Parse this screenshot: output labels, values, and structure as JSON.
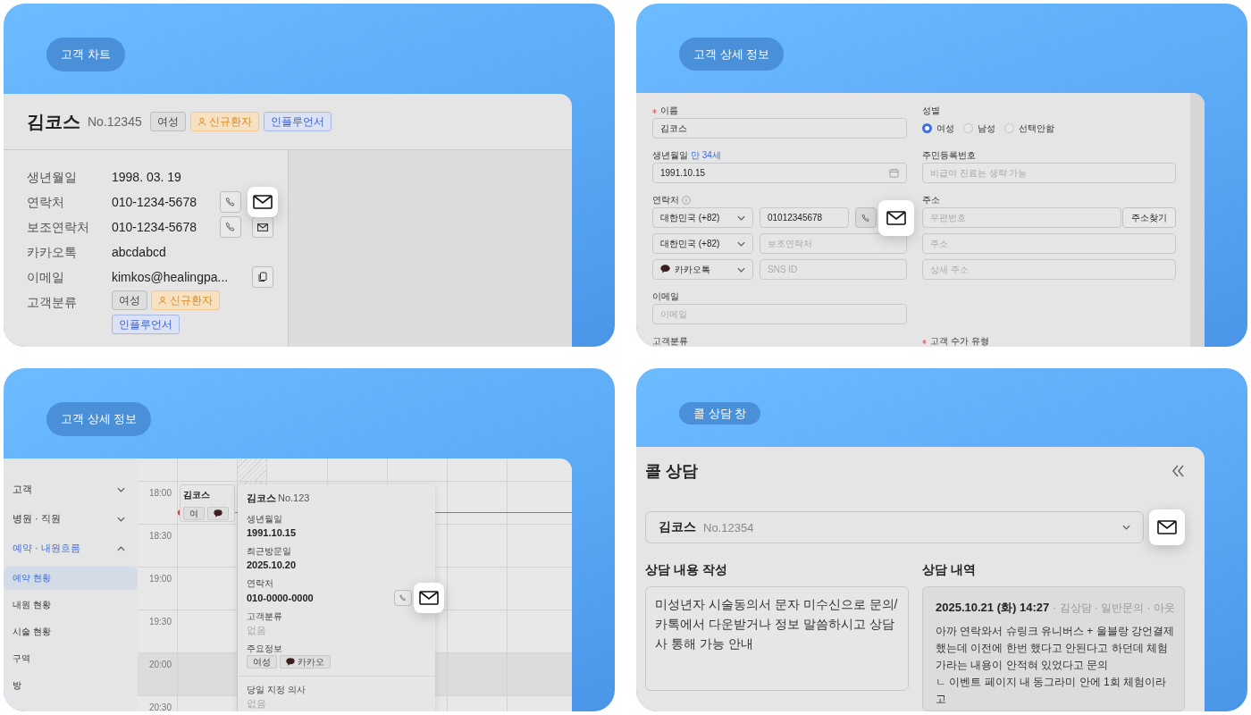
{
  "chart_panel": {
    "label": "고객 차트",
    "name": "김코스",
    "number": "No.12345",
    "tags": [
      {
        "text": "여성",
        "kind": "plain"
      },
      {
        "text": "신규환자",
        "kind": "new"
      },
      {
        "text": "인플루언서",
        "kind": "influencer"
      }
    ],
    "rows": [
      {
        "label": "생년월일",
        "kind": "text",
        "value": "1998. 03. 19"
      },
      {
        "label": "연락처",
        "kind": "contact",
        "value": "010-1234-5678",
        "highlighted": true
      },
      {
        "label": "보조연락처",
        "kind": "contact",
        "value": "010-1234-5678",
        "highlighted": false
      },
      {
        "label": "카카오톡",
        "kind": "text",
        "value": "abcdabcd"
      },
      {
        "label": "이메일",
        "kind": "copy",
        "value": "kimkos@healingpa..."
      },
      {
        "label": "고객분류",
        "kind": "tags",
        "tags": [
          {
            "text": "여성",
            "kind": "plain"
          },
          {
            "text": "신규환자",
            "kind": "new"
          },
          {
            "text": "인플루언서",
            "kind": "influencer"
          }
        ]
      }
    ]
  },
  "form_panel": {
    "label": "고객 상세 정보",
    "name": {
      "label": "이름",
      "required": true,
      "value": "김코스"
    },
    "gender": {
      "label": "성별",
      "options": [
        {
          "text": "여성",
          "selected": true
        },
        {
          "text": "남성",
          "selected": false
        },
        {
          "text": "선택안함",
          "selected": false
        }
      ]
    },
    "birth": {
      "label": "생년월일",
      "age": "만 34세",
      "value": "1991.10.15"
    },
    "rrn": {
      "label": "주민등록번호",
      "placeholder": "비급여 진료는 생략 가능"
    },
    "contact": {
      "label": "연락처",
      "rows": [
        {
          "kind": "phone",
          "country": "대한민국 (+82)",
          "value": "01012345678",
          "actions": true
        },
        {
          "kind": "phone",
          "country": "대한민국 (+82)",
          "placeholder": "보조연락처",
          "actions": false
        },
        {
          "kind": "sns",
          "country": "카카오톡",
          "placeholder": "SNS ID",
          "actions": false
        }
      ]
    },
    "address": {
      "label": "주소",
      "zip_placeholder": "우편번호",
      "search_button": "주소찾기",
      "address_placeholder": "주소",
      "detail_placeholder": "상세 주소"
    },
    "email": {
      "label": "이메일",
      "placeholder": "이메일"
    },
    "classification": {
      "label": "고객분류"
    },
    "fee_type": {
      "label": "고객 수가 유형",
      "required": true
    }
  },
  "calendar_panel": {
    "label": "고객 상세 정보",
    "menu": [
      {
        "text": "고객",
        "expanded": false
      },
      {
        "text": "병원 · 직원",
        "expanded": false
      },
      {
        "text": "예약 · 내원흐름",
        "expanded": true,
        "children": [
          {
            "text": "예약 현황",
            "selected": true
          },
          {
            "text": "내원 현황",
            "selected": false
          },
          {
            "text": "시술 현황",
            "selected": false
          },
          {
            "text": "구역",
            "selected": false
          },
          {
            "text": "방",
            "selected": false
          }
        ]
      }
    ],
    "times": [
      "18:00",
      "18:30",
      "19:00",
      "19:30",
      "20:00",
      "20:30"
    ],
    "event": {
      "name": "김코스",
      "chips": [
        {
          "kind": "text",
          "text": "여"
        },
        {
          "kind": "kakao"
        }
      ]
    },
    "popover": {
      "name": "김코스",
      "number": "No.123",
      "fields": [
        {
          "kind": "value",
          "label": "생년월일",
          "value": "1991.10.15",
          "empty": false
        },
        {
          "kind": "value",
          "label": "최근방문일",
          "value": "2025.10.20",
          "empty": false
        },
        {
          "kind": "value",
          "label": "연락처",
          "value": "010-0000-0000",
          "empty": false,
          "actions": true
        },
        {
          "kind": "value",
          "label": "고객분류",
          "value": "없음",
          "empty": true
        },
        {
          "kind": "chips",
          "label": "주요정보",
          "chips": [
            {
              "kind": "text",
              "text": "여성"
            },
            {
              "kind": "kakao",
              "text": "카카오"
            }
          ]
        }
      ],
      "doctor": {
        "label": "당일 지정 의사",
        "value": "없음",
        "empty": true
      }
    }
  },
  "call_panel": {
    "label": "콜 상담 창",
    "title": "콜 상담",
    "customer": {
      "name": "김코스",
      "number": "No.12354"
    },
    "note_title": "상담 내용 작성",
    "note": "미성년자 시술동의서 문자 미수신으로 문의/카톡에서 다운받거나 정보 말씀하시고 상담사 통해 가능 안내",
    "history_title": "상담 내역",
    "history": [
      {
        "date": "2025.10.21 (화) 14:27",
        "meta": "· 김상담 · 일반문의 · 아웃",
        "paragraphs": [
          "아까 연락와서 슈링크 유니버스 + 울블랑 강언결제했는데 이전에 한번 했다고 안된다고 하던데 체험가라는 내용이 안적혀 있었다고 문의",
          "ㄴ 이벤트 페이지 내 동그라미 안에 1회 체험이라고"
        ]
      }
    ]
  }
}
